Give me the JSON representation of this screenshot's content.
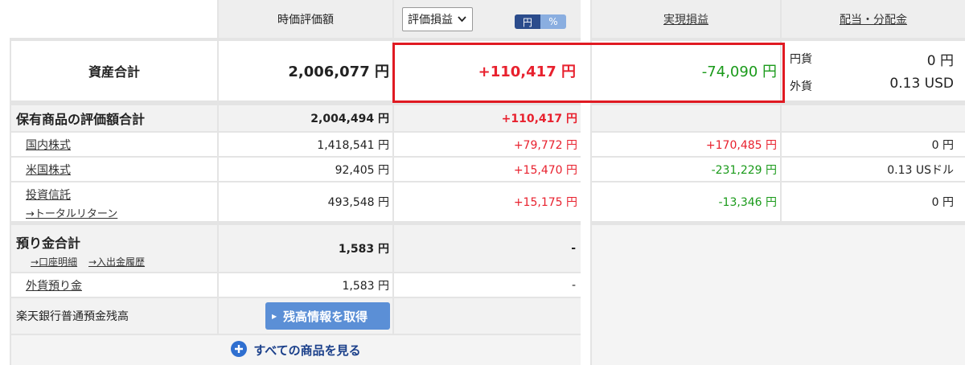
{
  "header": {
    "col_value": "時価評価額",
    "col_pl_select": "評価損益",
    "toggle_yen": "円",
    "toggle_pct": "%",
    "col_realized": "実現損益",
    "col_dividend": "配当・分配金"
  },
  "total_assets": {
    "label": "資産合計",
    "value": "2,006,077 円",
    "unrealized": "+110,417 円",
    "realized": "-74,090 円",
    "dividend_yen_label": "円貨",
    "dividend_yen_value": "0 円",
    "dividend_fx_label": "外貨",
    "dividend_fx_value": "0.13 USD"
  },
  "holdings": {
    "label": "保有商品の評価額合計",
    "value": "2,004,494 円",
    "unrealized": "+110,417 円",
    "rows": [
      {
        "label": "国内株式",
        "value": "1,418,541 円",
        "unrealized": "+79,772 円",
        "realized": "+170,485 円",
        "dividend": "0 円"
      },
      {
        "label": "米国株式",
        "value": "92,405 円",
        "unrealized": "+15,470 円",
        "realized": "-231,229 円",
        "dividend": "0.13 USドル"
      },
      {
        "label": "投資信託",
        "sublink": "→トータルリターン",
        "value": "493,548 円",
        "unrealized": "+15,175 円",
        "realized": "-13,346 円",
        "dividend": "0 円"
      }
    ]
  },
  "deposits": {
    "label": "預り金合計",
    "link_statement": "→口座明細",
    "link_history": "→入出金履歴",
    "value": "1,583 円",
    "unrealized": "-",
    "fx_label": "外貨預り金",
    "fx_value": "1,583 円",
    "fx_unrealized": "-"
  },
  "bank": {
    "label": "楽天銀行普通預金残高",
    "button": "残高情報を取得"
  },
  "footer": {
    "show_all": "すべての商品を見る"
  },
  "colors": {
    "positive": "#e8212e",
    "negative": "#1a9a1a",
    "highlight_box": "#e01a22",
    "button_blue": "#5b8fd6"
  }
}
